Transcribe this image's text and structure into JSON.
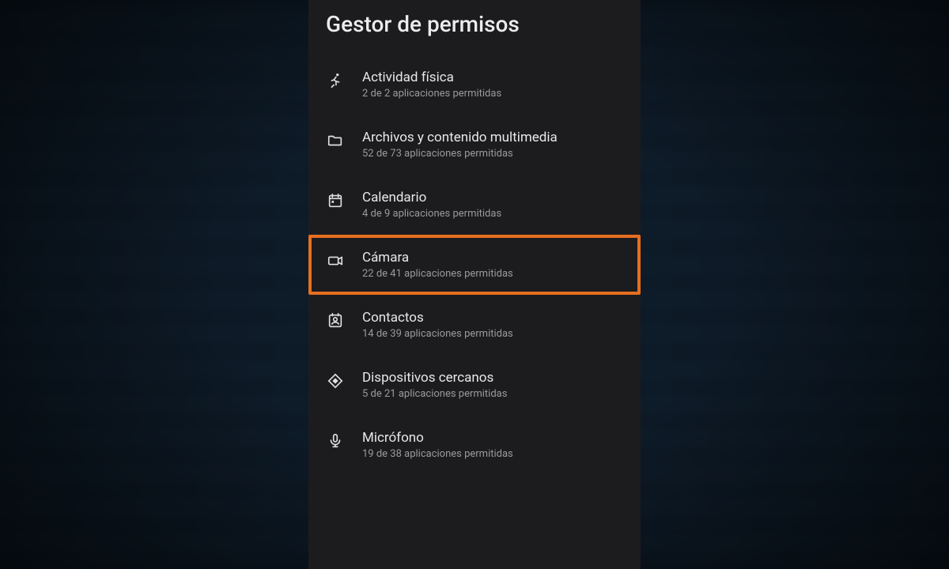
{
  "header": {
    "title": "Gestor de permisos"
  },
  "permissions": [
    {
      "icon": "running-icon",
      "label": "Actividad física",
      "subtitle": "2 de 2 aplicaciones permitidas",
      "highlight": false
    },
    {
      "icon": "folder-icon",
      "label": "Archivos y contenido multimedia",
      "subtitle": "52 de 73 aplicaciones permitidas",
      "highlight": false
    },
    {
      "icon": "calendar-icon",
      "label": "Calendario",
      "subtitle": "4 de 9 aplicaciones permitidas",
      "highlight": false
    },
    {
      "icon": "camera-icon",
      "label": "Cámara",
      "subtitle": "22 de 41 aplicaciones permitidas",
      "highlight": true
    },
    {
      "icon": "contacts-icon",
      "label": "Contactos",
      "subtitle": "14 de 39 aplicaciones permitidas",
      "highlight": false
    },
    {
      "icon": "nearby-icon",
      "label": "Dispositivos cercanos",
      "subtitle": "5 de 21 aplicaciones permitidas",
      "highlight": false
    },
    {
      "icon": "microphone-icon",
      "label": "Micrófono",
      "subtitle": "19 de 38 aplicaciones permitidas",
      "highlight": false
    }
  ],
  "colors": {
    "highlight": "#e76f1f",
    "panel_bg": "#1c1c1f"
  }
}
